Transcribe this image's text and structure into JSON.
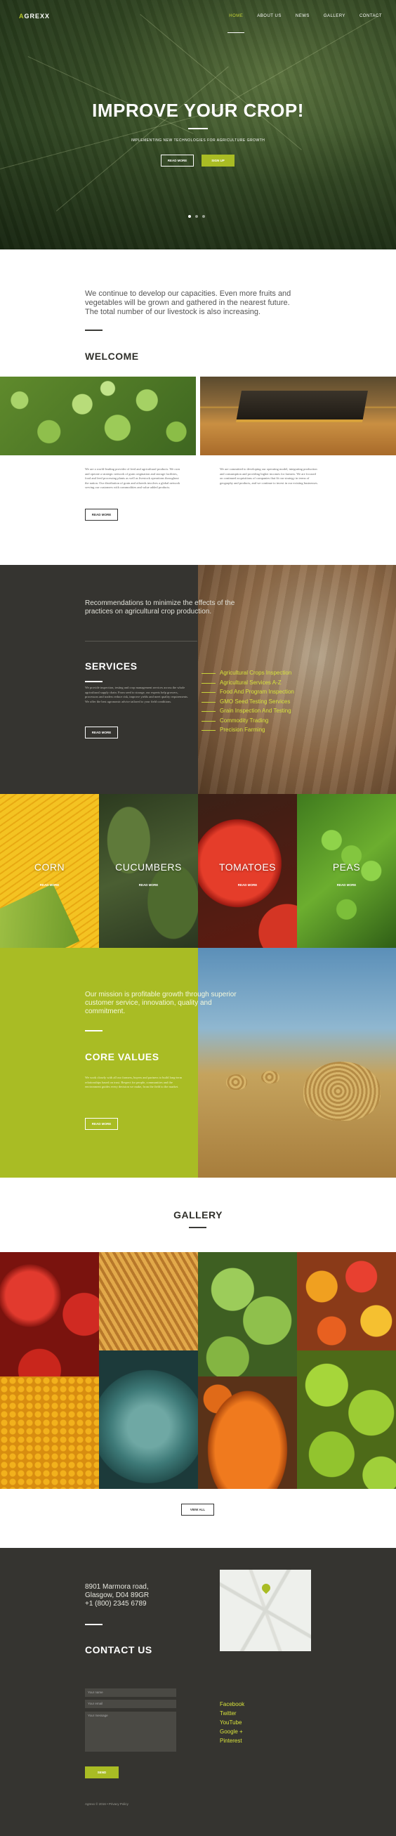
{
  "header": {
    "logo_prefix": "A",
    "logo_rest": "GREXX",
    "nav": [
      "HOME",
      "ABOUT US",
      "NEWS",
      "GALLERY",
      "CONTACT"
    ],
    "active_nav": "HOME"
  },
  "hero": {
    "title": "IMPROVE YOUR CROP!",
    "subtitle": "IMPLEMENTING NEW TECHNOLOGIES FOR AGRICULTURE GROWTH",
    "btn_more": "READ MORE",
    "btn_signup": "SIGN UP",
    "slides": 3,
    "active_slide": 1
  },
  "intro": {
    "text": "We continue to develop our capacities. Even more fruits and vegetables will be grown and gathered in the nearest future. The total number of our livestock is also increasing."
  },
  "welcome": {
    "title": "WELCOME",
    "col1": "We are a world-leading provider of feed and agricultural products. We own and operate a strategic network of grain origination and storage facilities, food and feed processing plants as well as livestock operations throughout the nation. Our distribution of grain and oilseeds involves a global network serving our customers with commodities and value added products.",
    "col2": "We are committed to developing our operating model, integrating production and consumption and providing higher incomes for farmers. We are focused on continued acquisitions of companies that fit our strategy in terms of geography and products, and we continue to invest in our existing businesses.",
    "btn": "READ MORE"
  },
  "services": {
    "quote": "Recommendations to minimize the effects of the practices on agricultural crop production.",
    "title": "SERVICES",
    "text": "We provide inspection, testing and crop management services across the whole agricultural supply chain. From seed to storage, our experts help growers, processors and traders reduce risk, improve yields and meet quality requirements. We offer the best agronomic advice tailored to your field conditions.",
    "btn": "READ MORE",
    "list": [
      "Agricultural Crops Inspection",
      "Agricultural Services A-Z",
      "Food And Program Inspection",
      "GMO Seed Testing Services",
      "Grain Inspection And Testing",
      "Commodity Trading",
      "Precision Farming"
    ]
  },
  "crops": [
    {
      "label": "CORN",
      "more": "READ MORE"
    },
    {
      "label": "CUCUMBERS",
      "more": "READ MORE"
    },
    {
      "label": "TOMATOES",
      "more": "READ MORE"
    },
    {
      "label": "PEAS",
      "more": "READ MORE"
    }
  ],
  "core": {
    "quote": "Our mission is profitable growth through superior customer service, innovation, quality and commitment.",
    "title": "CORE VALUES",
    "text": "We work closely with all our farmers, buyers and partners to build long-term relationships based on trust. Respect for people, communities and the environment guides every decision we make, from the field to the market.",
    "btn": "READ MORE"
  },
  "gallery": {
    "title": "GALLERY",
    "btn": "VIEW ALL"
  },
  "footer": {
    "address": [
      "8901 Marmora road,",
      "Glasgow, D04 89GR",
      "+1 (800) 2345 6789"
    ],
    "contact_title": "CONTACT US",
    "name_placeholder": "Your name",
    "email_placeholder": "Your email",
    "message_placeholder": "Your message",
    "send": "SEND",
    "social": [
      "Facebook",
      "Twitter",
      "YouTube",
      "Google +",
      "Pinterest"
    ],
    "copyright": "Agrexx © 2016 • Privacy Policy"
  },
  "colors": {
    "accent": "#a9bc24",
    "dark": "#353430",
    "link": "#d7e23c"
  }
}
